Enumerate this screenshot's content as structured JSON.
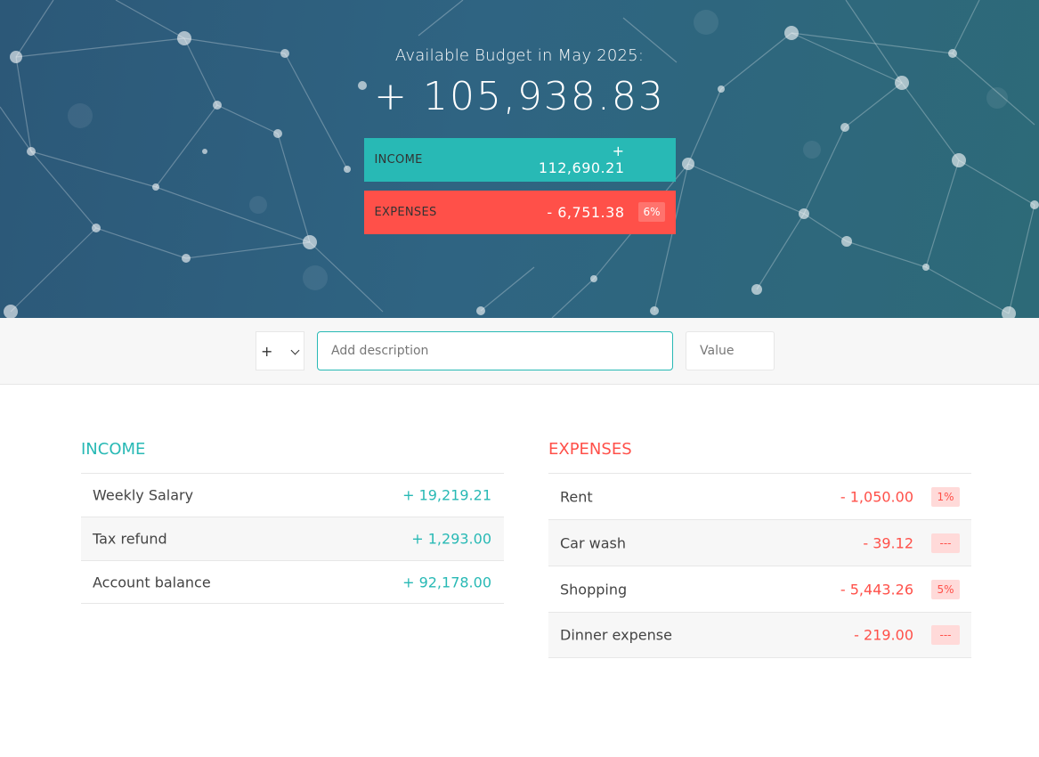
{
  "budget": {
    "title": "Available Budget in May 2025:",
    "value": "+ 105,938.83"
  },
  "summary": {
    "income": {
      "label": "INCOME",
      "value": "+ 112,690.21"
    },
    "expenses": {
      "label": "EXPENSES",
      "value": "- 6,751.38",
      "percentage": "6%"
    }
  },
  "add_form": {
    "type_value": "+",
    "description_placeholder": "Add description",
    "value_placeholder": "Value"
  },
  "income": {
    "title": "INCOME",
    "items": [
      {
        "description": "Weekly Salary",
        "value": "+ 19,219.21"
      },
      {
        "description": "Tax refund",
        "value": "+ 1,293.00"
      },
      {
        "description": "Account balance",
        "value": "+ 92,178.00"
      }
    ]
  },
  "expenses": {
    "title": "EXPENSES",
    "items": [
      {
        "description": "Rent",
        "value": "- 1,050.00",
        "percentage": "1%"
      },
      {
        "description": "Car wash",
        "value": "- 39.12",
        "percentage": "---"
      },
      {
        "description": "Shopping",
        "value": "- 5,443.26",
        "percentage": "5%"
      },
      {
        "description": "Dinner expense",
        "value": "- 219.00",
        "percentage": "---"
      }
    ]
  },
  "colors": {
    "income_accent": "#28b9b5",
    "expense_accent": "#ff5049",
    "header_background": "#2e5f7e"
  }
}
